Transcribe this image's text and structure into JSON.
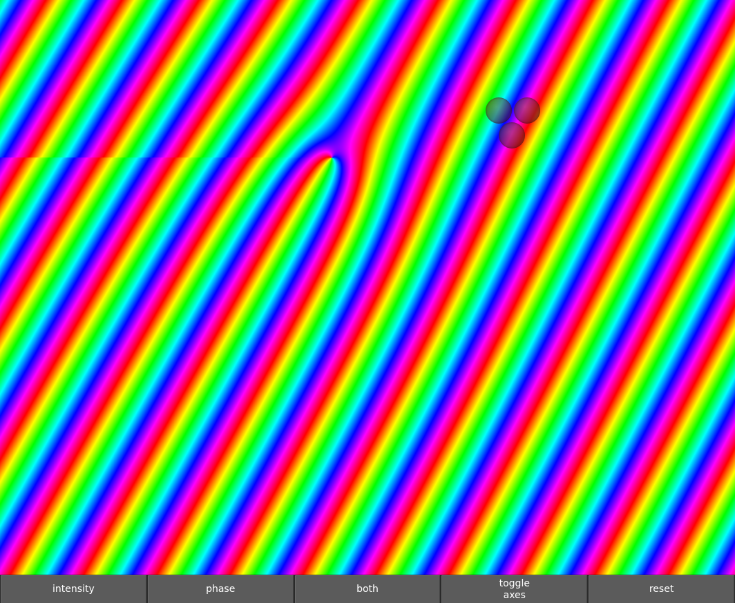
{
  "visualization": {
    "mode": "phase",
    "color_cycle": [
      "#ff0000",
      "#ffff00",
      "#00ff00",
      "#00ffff",
      "#0000ff",
      "#ff00ff"
    ],
    "probe_count": 3,
    "probe_color": "#6b2f2f"
  },
  "toolbar": {
    "intensity_label": "intensity",
    "phase_label": "phase",
    "both_label": "both",
    "toggle_axes_line1": "toggle",
    "toggle_axes_line2": "axes",
    "reset_label": "reset"
  }
}
